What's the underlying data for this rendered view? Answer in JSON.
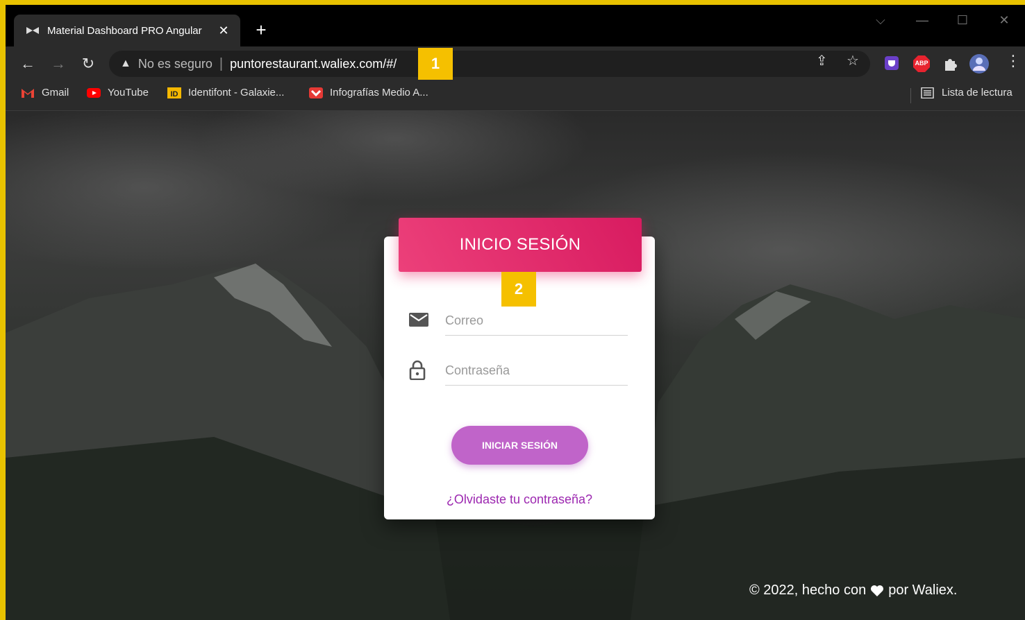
{
  "browser": {
    "tab": {
      "title": "Material Dashboard PRO Angular",
      "close_glyph": "✕"
    },
    "new_tab_glyph": "+",
    "window_controls": {
      "dropdown": "⌵",
      "minimize": "—",
      "maximize": "☐",
      "close": "✕"
    },
    "nav": {
      "back": "←",
      "forward": "→",
      "reload": "↻"
    },
    "omnibox": {
      "warning_glyph": "▲",
      "security_label": "No es seguro",
      "separator": "|",
      "url": "puntorestaurant.waliex.com/#/"
    },
    "toolbar_icons": {
      "share": "⇪",
      "star": "☆",
      "menu": "⋮",
      "abp_label": "ABP"
    },
    "bookmarks": [
      {
        "label": "Gmail",
        "icon": "gmail-icon",
        "color": "#ea4335"
      },
      {
        "label": "YouTube",
        "icon": "youtube-icon",
        "color": "#ff0000"
      },
      {
        "label": "Identifont - Galaxie...",
        "icon": "identifont-icon",
        "color": "#f5b800"
      },
      {
        "label": "Infografías Medio A...",
        "icon": "infografias-icon",
        "color": "#e53935"
      }
    ],
    "reading_list": {
      "label": "Lista de lectura"
    }
  },
  "markers": {
    "one": "1",
    "two": "2"
  },
  "login": {
    "title": "INICIO SESIÓN",
    "email_placeholder": "Correo",
    "password_placeholder": "Contraseña",
    "submit_label": "INICIAR SESIÓN",
    "forgot_link": "¿Olvidaste tu contraseña?"
  },
  "footer": {
    "prefix": "© 2022, hecho con",
    "suffix": "por Waliex."
  },
  "colors": {
    "header_pink": "#e91e63",
    "button_purple": "#c064c9",
    "link_purple": "#9c27b0",
    "marker_yellow": "#f5c000"
  }
}
